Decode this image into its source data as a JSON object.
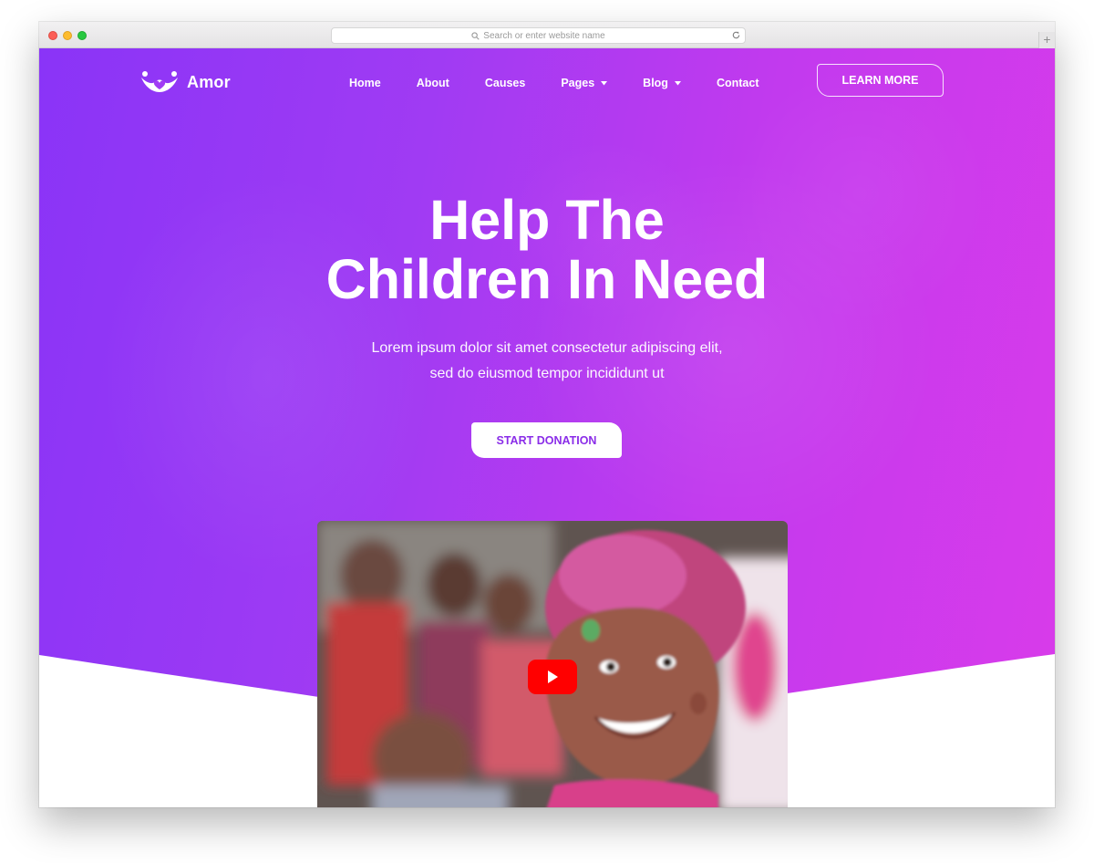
{
  "browser": {
    "url_placeholder": "Search or enter website name",
    "new_tab_symbol": "+"
  },
  "nav": {
    "logo_text": "Amor",
    "items": [
      {
        "label": "Home",
        "has_dropdown": false
      },
      {
        "label": "About",
        "has_dropdown": false
      },
      {
        "label": "Causes",
        "has_dropdown": false
      },
      {
        "label": "Pages",
        "has_dropdown": true
      },
      {
        "label": "Blog",
        "has_dropdown": true
      },
      {
        "label": "Contact",
        "has_dropdown": false
      }
    ],
    "cta_label": "LEARN MORE"
  },
  "hero": {
    "title_line1": "Help The",
    "title_line2": "Children In Need",
    "subtitle_line1": "Lorem ipsum dolor sit amet consectetur adipiscing elit,",
    "subtitle_line2": "sed do eiusmod tempor incididunt ut",
    "donate_label": "START DONATION"
  },
  "video": {
    "play_icon": "youtube-play-icon"
  },
  "colors": {
    "gradient_start": "#8a34f7",
    "gradient_end": "#d93bea",
    "accent_text": "#8a2de8",
    "play_red": "#ff0000"
  }
}
